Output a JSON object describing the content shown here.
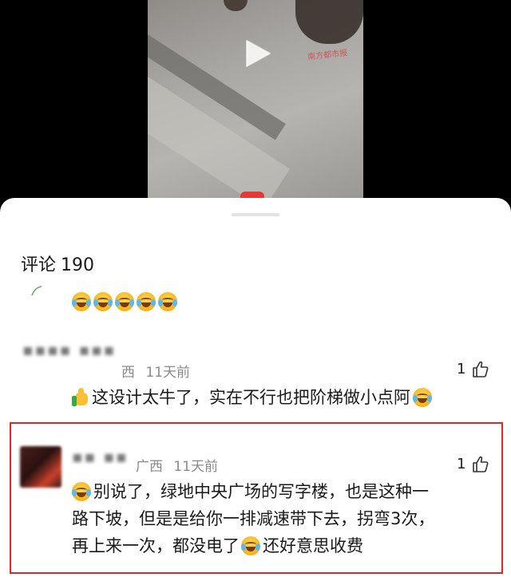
{
  "video": {
    "watermark": "南方都市报"
  },
  "comments_header": {
    "label": "评论",
    "count": "190"
  },
  "comments": [
    {
      "emoji_reactions": [
        "grin-tears-icon",
        "grin-tears-icon",
        "grin-tears-icon",
        "grin-tears-icon",
        "grin-tears-icon"
      ]
    },
    {
      "location": "西",
      "time": "11天前",
      "likes": "1",
      "text": "这设计太牛了，实在不行也把阶梯做小点阿"
    },
    {
      "location": "广西",
      "time": "11天前",
      "likes": "1",
      "text_line1": "别说了，绿地中央广场的写字楼，也是这种一",
      "text_line2": "路下坡，但是是给你一排减速带下去，拐弯3次，",
      "text_line3_a": "再上来一次，都没电了",
      "text_line3_b": "还好意思收费"
    }
  ],
  "colors": {
    "highlight": "#e0262b",
    "sheet_bg": "#ffffff",
    "meta_text": "#8a8a8a"
  }
}
